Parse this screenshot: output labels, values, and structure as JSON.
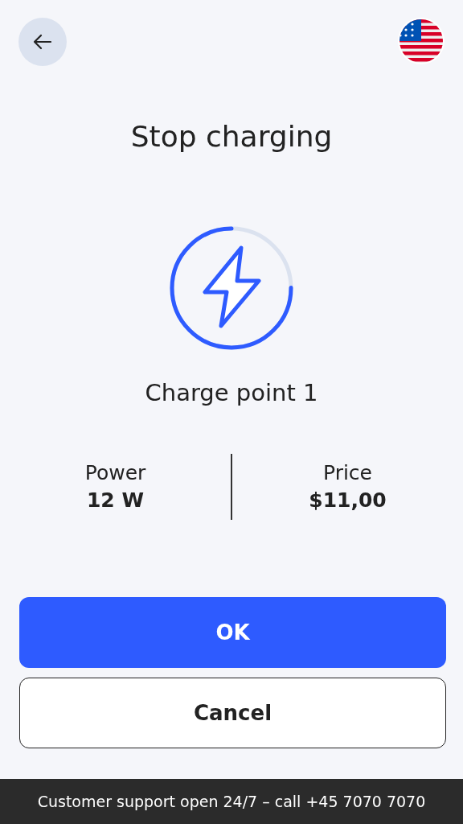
{
  "header": {
    "title": "Stop charging"
  },
  "charging": {
    "charge_point": "Charge point 1"
  },
  "stats": [
    {
      "label": "Power",
      "value": "12 W"
    },
    {
      "label": "Price",
      "value": "$11,00"
    }
  ],
  "buttons": [
    {
      "label": "OK",
      "kind": "primary"
    },
    {
      "label": "Cancel",
      "kind": "secondary"
    }
  ],
  "footer": "Customer support open 24/7 – call +45 7070 7070"
}
